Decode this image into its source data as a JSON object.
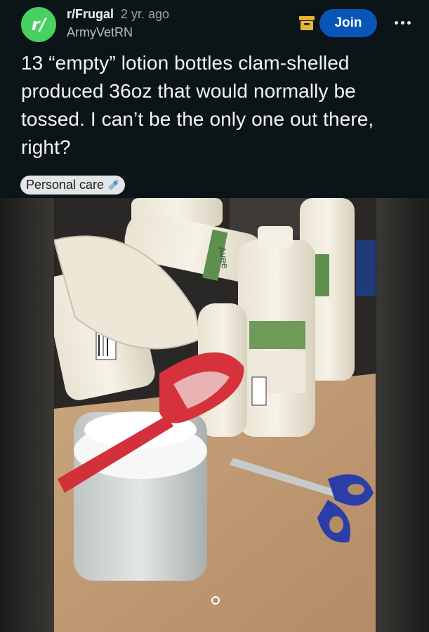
{
  "post": {
    "subreddit": "r/Frugal",
    "age": "2 yr. ago",
    "author": "ArmyVetRN",
    "avatar_text": "r/",
    "join_label": "Join",
    "title": "13 “empty” lotion bottles clam-shelled produced 36oz that would normally be tossed. I can’t be the only one out there, right?",
    "flair": "Personal care"
  },
  "icons": {
    "avatar": "subreddit-avatar-icon",
    "archive": "archive-icon",
    "more": "more-options-icon",
    "flair": "lotion-bottle-icon",
    "gallery": "gallery-indicator-icon"
  },
  "image": {
    "description_label": "Avee"
  },
  "colors": {
    "background": "#0b1416",
    "join": "#0a56b8",
    "avatar": "#46d160",
    "archive_icon": "#e6b437",
    "flair_bg": "#e3e6e7"
  }
}
